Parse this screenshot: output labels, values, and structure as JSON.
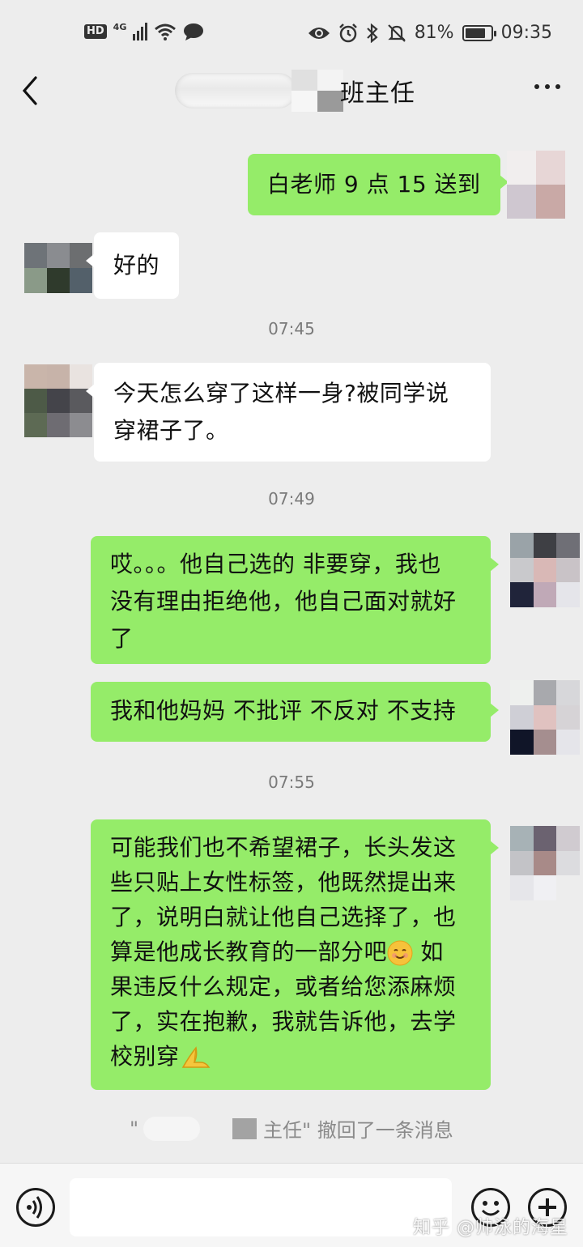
{
  "status_bar": {
    "hd": "HD",
    "network": "4G",
    "battery": "81%",
    "battery_level": 0.81,
    "time": "09:35"
  },
  "navbar": {
    "title": "班主任"
  },
  "messages": [
    {
      "direction": "out",
      "text": "白老师 9 点 15 送到"
    },
    {
      "direction": "in",
      "text": "好的"
    },
    {
      "timestamp": "07:45"
    },
    {
      "direction": "in",
      "lines": [
        "今天怎么穿了这样一身?被同学说",
        "穿裙子了。"
      ]
    },
    {
      "timestamp": "07:49"
    },
    {
      "direction": "out",
      "lines": [
        "哎。。。他自己选的 非要穿，我也",
        "没有理由拒绝他，他自己面对就好",
        "了"
      ]
    },
    {
      "direction": "out",
      "text": "我和他妈妈 不批评 不反对 不支持"
    },
    {
      "timestamp": "07:55"
    },
    {
      "direction": "out",
      "lines": [
        "可能我们也不希望裙子，长头发这",
        "些只贴上女性标签，他既然提出来",
        "了，说明白就让他自己选择了，也",
        "算是他成长教育的一部分吧",
        " 如",
        "果违反什么规定，或者给您添麻烦",
        "了，实在抱歉，我就告诉他，去学",
        "校别穿"
      ]
    }
  ],
  "recall_notice": {
    "prefix": "\"",
    "suffix": "主任\" 撤回了一条消息"
  },
  "input_bar": {
    "placeholder": ""
  },
  "watermark": "知乎 @帅泳的海星",
  "colors": {
    "background": "#ededed",
    "outgoing_bubble": "#95ec69",
    "incoming_bubble": "#ffffff"
  },
  "icons": [
    "hd-icon",
    "signal-icon",
    "wifi-icon",
    "chat-icon",
    "eye-icon",
    "alarm-icon",
    "bluetooth-icon",
    "mute-icon",
    "battery-icon",
    "back-icon",
    "more-icon",
    "voice-icon",
    "emoji-icon",
    "plus-icon",
    "smile-emoji",
    "pray-emoji"
  ]
}
